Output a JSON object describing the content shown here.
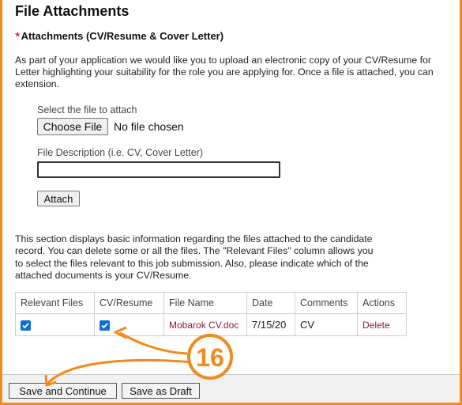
{
  "page": {
    "title": "File Attachments"
  },
  "attachments": {
    "required_marker": "*",
    "heading": "Attachments (CV/Resume & Cover Letter)",
    "intro_lines": [
      "As part of your application we would like you to upload an electronic copy of your CV/Resume for",
      "Letter highlighting your suitability for the role you are applying for. Once a file is attached, you can",
      "extension."
    ]
  },
  "upload": {
    "select_label": "Select the file to attach",
    "choose_button": "Choose File",
    "no_file_text": "No file chosen",
    "description_label": "File Description (i.e. CV, Cover Letter)",
    "description_value": "",
    "attach_button": "Attach"
  },
  "info_lines": [
    "This section displays basic information regarding the files attached to the candidate",
    "record. You can delete some or all the files. The \"Relevant Files\" column allows you",
    "to select the files relevant to this job submission. Also, please indicate which of the",
    "attached documents is your CV/Resume."
  ],
  "table": {
    "headers": [
      "Relevant Files",
      "CV/Resume",
      "File Name",
      "Date",
      "Comments",
      "Actions"
    ],
    "rows": [
      {
        "relevant": true,
        "cv": true,
        "file_name": "Mobarok CV.doc",
        "date": "7/15/20",
        "comments": "CV",
        "action": "Delete"
      }
    ]
  },
  "annotation": {
    "step_number": "16",
    "color": "#f28a1c"
  },
  "footer": {
    "save_continue": "Save and Continue",
    "save_draft": "Save as Draft"
  },
  "colors": {
    "accent": "#0b6fd6",
    "link": "#8a1c3c",
    "required": "#d0021b",
    "frame": "#f28a1c"
  }
}
